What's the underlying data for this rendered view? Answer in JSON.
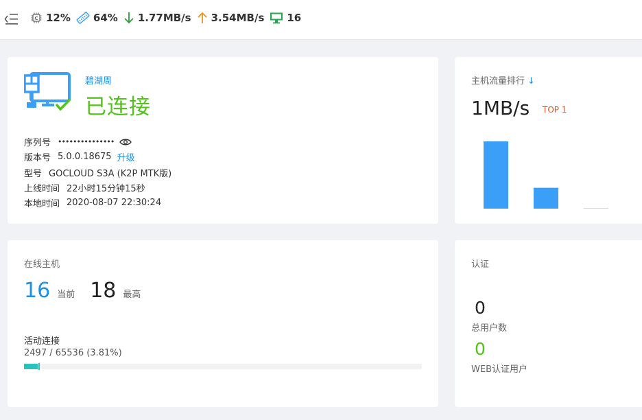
{
  "topbar": {
    "cpu": "12%",
    "memory": "64%",
    "download": "1.77MB/s",
    "upload": "3.54MB/s",
    "hosts": "16"
  },
  "router": {
    "name": "碧湖周",
    "status": "已连接",
    "serial_label": "序列号",
    "serial_value": "•••••••••••••••",
    "version_label": "版本号",
    "version_value": "5.0.0.18675",
    "upgrade_label": "升级",
    "model_label": "型号",
    "model_value": "GOCLOUD S3A (K2P MTK版)",
    "uptime_label": "上线时间",
    "uptime_value": "22小时15分钟15秒",
    "local_time_label": "本地时间",
    "local_time_value": "2020-08-07 22:30:24"
  },
  "traffic": {
    "title": "主机流量排行",
    "sort_icon": "↓",
    "value": "1MB/s",
    "badge": "TOP 1",
    "bars": [
      1.0,
      0.31,
      0.01
    ],
    "bar_color": "#3b9ff8"
  },
  "hosts": {
    "title": "在线主机",
    "current": "16",
    "current_label": "当前",
    "max": "18",
    "max_label": "最高",
    "conn_label": "活动连接",
    "conn_value": "2497 / 65536 (3.81%)",
    "conn_fraction": 0.0381
  },
  "auth": {
    "title": "认证",
    "total_users": "0",
    "total_users_label": "总用户数",
    "web_users": "0",
    "web_users_label": "WEB认证用户"
  },
  "colors": {
    "accent": "#1e90e6",
    "success": "#52c41a",
    "download_arrow": "#2e9e3e",
    "upload_arrow": "#e8941f",
    "hosts_icon": "#22a84a"
  }
}
